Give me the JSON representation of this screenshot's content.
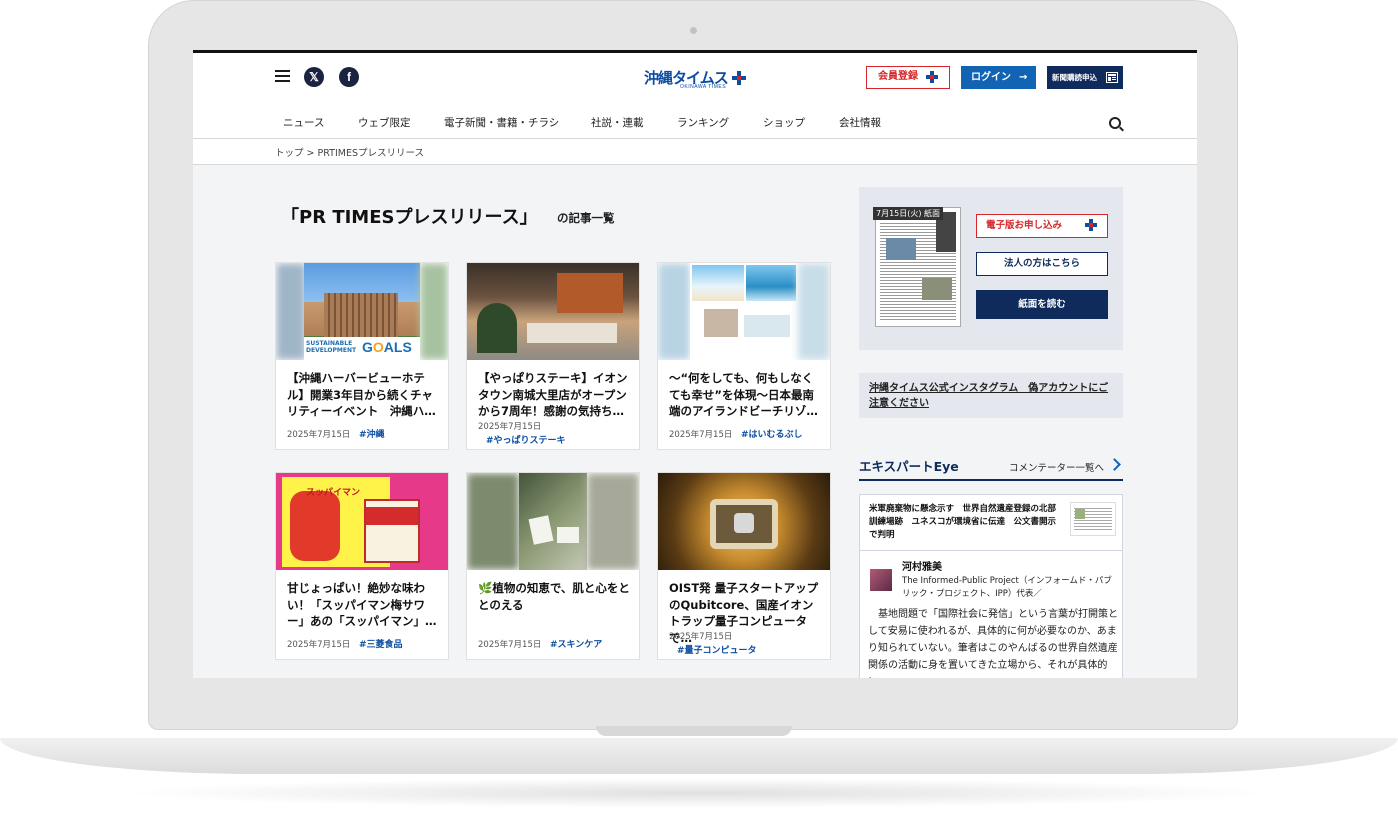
{
  "header": {
    "logo_text": "沖縄タイムス",
    "logo_sub": "OKINAWA TIMES",
    "member_button": "会員登録",
    "login_button": "ログイン",
    "subscribe_button": "新聞購読申込"
  },
  "nav": {
    "items": [
      "ニュース",
      "ウェブ限定",
      "電子新聞・書籍・チラシ",
      "社説・連載",
      "ランキング",
      "ショップ",
      "会社情報"
    ]
  },
  "breadcrumb": "トップ > PRTIMESプレスリリース",
  "page": {
    "title": "「PR TIMESプレスリリース」",
    "title_suffix": "の記事一覧"
  },
  "articles": [
    {
      "title": "【沖縄ハーバービューホテル】開業3年目から続くチャリティーイベント　沖縄ハ…",
      "date": "2025年7月15日",
      "tag": "#沖縄",
      "thumb_text": "SUSTAINABLE DEVELOPMENT GOALS"
    },
    {
      "title": "【やっぱりステーキ】イオンタウン南城大里店がオープンから7周年！感謝の気持ち…",
      "date": "2025年7月15日",
      "tag": "#やっぱりステーキ"
    },
    {
      "title": "〜“何をしても、何もしなくても幸せ”を体現〜日本最南端のアイランドビーチリゾ…",
      "date": "2025年7月15日",
      "tag": "#はいむるぶし"
    },
    {
      "title": "甘じょっぱい！絶妙な味わい！「スッパイマン梅サワー」あの「スッパイマン」…",
      "date": "2025年7月15日",
      "tag": "#三菱食品",
      "thumb_text": "スッパイマン"
    },
    {
      "title": "🌿植物の知恵で、肌と心をととのえる",
      "date": "2025年7月15日",
      "tag": "#スキンケア"
    },
    {
      "title": "OIST発 量子スタートアップのQubitcore、国産イオントラップ量子コンピュータで…",
      "date": "2025年7月15日",
      "tag": "#量子コンピュータ"
    }
  ],
  "sidebar": {
    "paper_date": "7月15日(火) 紙面",
    "digital_button": "電子版お申し込み",
    "corporate_button": "法人の方はこちら",
    "read_button": "紙面を読む",
    "notice": "沖縄タイムス公式インスタグラム　偽アカウントにご注意ください",
    "expert_title": "エキスパートEye",
    "expert_more": "コメンテーター一覧へ",
    "expert_headline": "米軍廃棄物に懸念示す　世界自然遺産登録の北部訓練場跡　ユネスコが環境省に伝達　公文書開示で判明",
    "expert_name": "河村雅美",
    "expert_affiliation": "The Informed-Public Project（インフォームド・パブリック・プロジェクト、IPP）代表／",
    "expert_text": "基地問題で「国際社会に発信」という言葉が打開策として安易に使われるが、具体的に何が必要なのか、あまり知られていない。筆者はこのやんばるの世界自然遺産関係の活動に身を置いてきた立場から、それが具体的に…"
  },
  "colors": {
    "brand_blue": "#0c4da2",
    "navy": "#0e2b5c",
    "red": "#d6262b",
    "login_blue": "#1164b4"
  }
}
